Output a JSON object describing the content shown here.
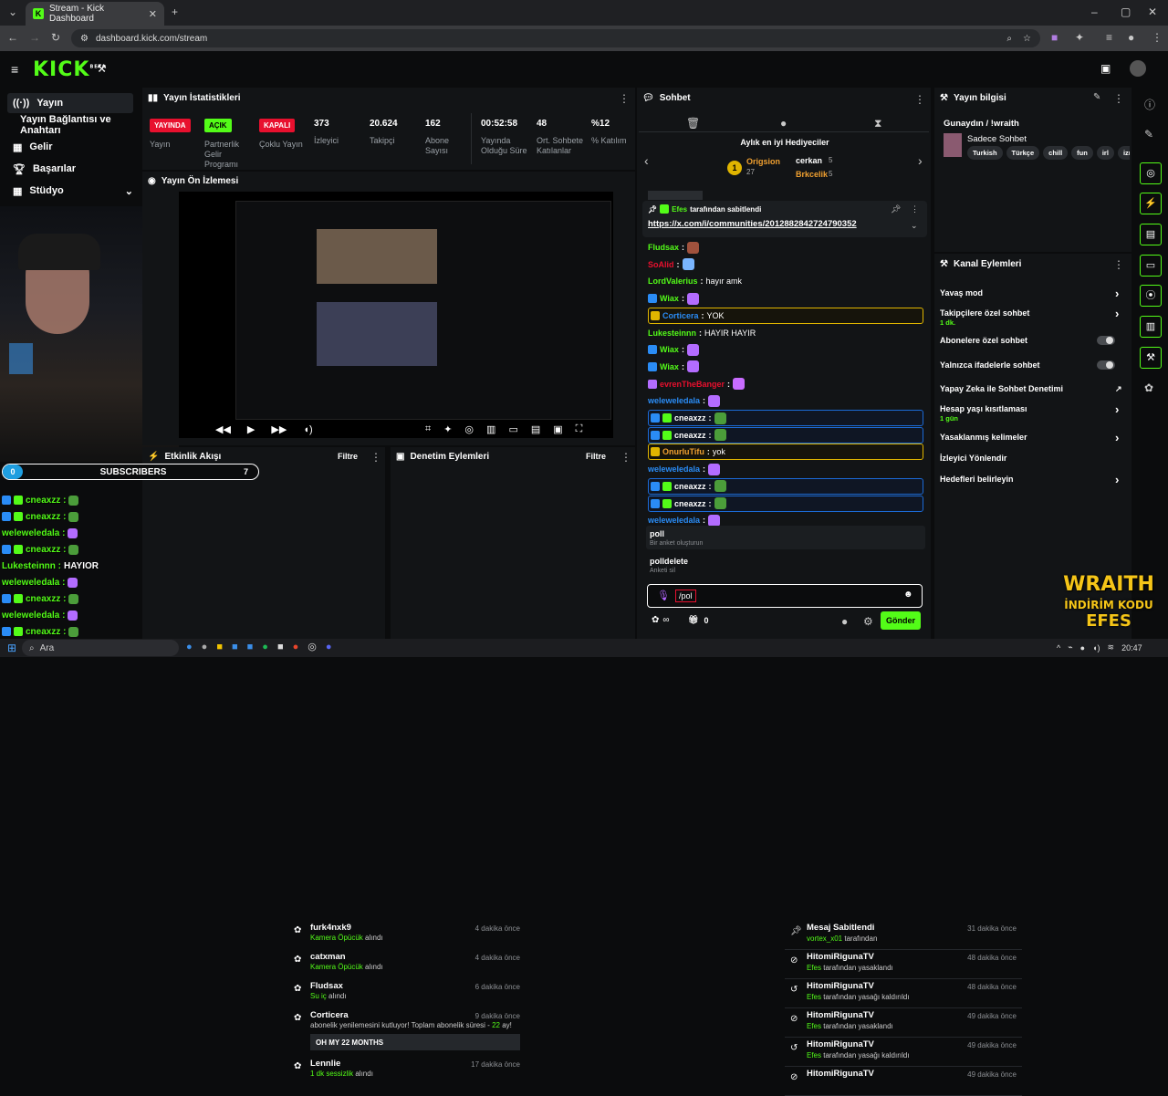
{
  "browser": {
    "tab_title": "Stream - Kick Dashboard",
    "url": "dashboard.kick.com/stream"
  },
  "header": {
    "logo": "KICK",
    "beta": "BETA"
  },
  "sidebar": {
    "items": [
      {
        "label": "Yayın",
        "icon": "broadcast-icon"
      },
      {
        "label": "Yayın Bağlantısı ve Anahtarı"
      },
      {
        "label": "Gelir",
        "icon": "grid-icon"
      },
      {
        "label": "Başarılar",
        "icon": "trophy-icon"
      },
      {
        "label": "Stüdyo",
        "icon": "grid-icon"
      }
    ]
  },
  "stats": {
    "title": "Yayın İstatistikleri",
    "badges": [
      {
        "text": "YAYINDA",
        "label": "Yayın",
        "color": "#e8102e"
      },
      {
        "text": "AÇIK",
        "label": "Partnerlik Gelir Programı",
        "color": "#53fc18"
      },
      {
        "text": "KAPALI",
        "label": "Çoklu Yayın",
        "color": "#e8102e"
      }
    ],
    "items": [
      {
        "value": "373",
        "label": "İzleyici"
      },
      {
        "value": "20.624",
        "label": "Takipçi"
      },
      {
        "value": "162",
        "label": "Abone Sayısı"
      },
      {
        "value": "00:52:58",
        "label": "Yayında Olduğu Süre"
      },
      {
        "value": "48",
        "label": "Ort. Sohbete Katılanlar"
      },
      {
        "value": "%12",
        "label": "% Katılım"
      }
    ]
  },
  "preview": {
    "title": "Yayın Ön İzlemesi"
  },
  "activity": {
    "title": "Etkinlik Akışı",
    "filter": "Filtre",
    "items": [
      {
        "name": "furk4nxk9",
        "sub": "Kamera Öpücük",
        "suffix": "alındı",
        "time": "4 dakika önce"
      },
      {
        "name": "catxman",
        "sub": "Kamera Öpücük",
        "suffix": "alındı",
        "time": "4 dakika önce"
      },
      {
        "name": "Fludsax",
        "sub": "Su iç",
        "suffix": "alındı",
        "time": "6 dakika önce"
      },
      {
        "name": "Corticera",
        "sub": "abonelik yenilemesini kutluyor! Toplam abonelik süresi - ",
        "sub2": "22",
        "sub3": " ay!",
        "time": "9 dakika önce",
        "msg": "OH MY 22 MONTHS"
      },
      {
        "name": "Lennlie",
        "sub": "1 dk sessizlik",
        "suffix": "alındı",
        "time": "17 dakika önce"
      }
    ]
  },
  "moderation": {
    "title": "Denetim Eylemleri",
    "filter": "Filtre",
    "items": [
      {
        "title": "Mesaj Sabitlendi",
        "user": "vortex_x01",
        "rest": "tarafından",
        "time": "31 dakika önce"
      },
      {
        "title": "HitomiRigunaTV",
        "user": "Efes",
        "rest": "tarafından yasaklandı",
        "time": "48 dakika önce"
      },
      {
        "title": "HitomiRigunaTV",
        "user": "Efes",
        "rest": "tarafından yasağı kaldırıldı",
        "time": "48 dakika önce"
      },
      {
        "title": "HitomiRigunaTV",
        "user": "Efes",
        "rest": "tarafından yasaklandı",
        "time": "49 dakika önce"
      },
      {
        "title": "HitomiRigunaTV",
        "user": "Efes",
        "rest": "tarafından yasağı kaldırıldı",
        "time": "49 dakika önce"
      },
      {
        "title": "HitomiRigunaTV",
        "time": "49 dakika önce"
      }
    ]
  },
  "chat": {
    "title": "Sohbet",
    "gifters_title": "Aylık en iyi Hediyeciler",
    "top1": {
      "name": "Origsion",
      "count": "27"
    },
    "top2": {
      "name": "cerkan",
      "count": "5"
    },
    "top3": {
      "name": "Brkcelik",
      "count": "5"
    },
    "pinned_by": "Efes",
    "pinned_suffix": "tarafından sabitlendi",
    "pinned_link": "https://x.com/i/communities/2012882842724790352",
    "messages": [
      {
        "user": "Fludsax",
        "color": "#53fc18",
        "text": "",
        "style": "none"
      },
      {
        "user": "SoAlid",
        "color": "#e8102e",
        "text": "",
        "style": "none"
      },
      {
        "user": "LordValerius",
        "color": "#53fc18",
        "text": " hayır amk",
        "style": "none"
      },
      {
        "user": "Wiax",
        "color": "#53fc18",
        "text": "",
        "style": "none"
      },
      {
        "user": "Corticera",
        "color": "#2a8cf6",
        "text": " YOK",
        "style": "hl"
      },
      {
        "user": "Lukesteinnn",
        "color": "#53fc18",
        "text": " HAYIR HAYIR",
        "style": "none"
      },
      {
        "user": "Wiax",
        "color": "#53fc18",
        "text": "",
        "style": "none"
      },
      {
        "user": "Wiax",
        "color": "#53fc18",
        "text": "",
        "style": "none"
      },
      {
        "user": "evrenTheBanger",
        "color": "#e8102e",
        "text": "",
        "style": "none"
      },
      {
        "user": "weleweledala",
        "color": "#2a8cf6",
        "text": "",
        "style": "none"
      },
      {
        "user": "cneaxzz",
        "color": "#fff",
        "text": "",
        "style": "bl"
      },
      {
        "user": "cneaxzz",
        "color": "#fff",
        "text": "",
        "style": "bl"
      },
      {
        "user": "OnurluTifu",
        "color": "#f0a030",
        "text": " yok",
        "style": "hl"
      },
      {
        "user": "weleweledala",
        "color": "#2a8cf6",
        "text": "",
        "style": "none"
      },
      {
        "user": "cneaxzz",
        "color": "#fff",
        "text": "",
        "style": "bl"
      },
      {
        "user": "cneaxzz",
        "color": "#fff",
        "text": "",
        "style": "bl"
      },
      {
        "user": "weleweledala",
        "color": "#2a8cf6",
        "text": "",
        "style": "none"
      }
    ],
    "commands": [
      {
        "cmd": "poll",
        "desc": "Bir anket oluşturun"
      },
      {
        "cmd": "polldelete",
        "desc": "Anketi sil"
      }
    ],
    "input_value": "/pol",
    "count": "0",
    "send": "Gönder"
  },
  "stream_info": {
    "title": "Yayın bilgisi",
    "stream_title": "Gunaydın / !wraith",
    "mode": "Sadece Sohbet",
    "tags": [
      "Turkish",
      "Türkçe",
      "chill",
      "fun",
      "irl",
      "izm"
    ]
  },
  "channel_actions": {
    "title": "Kanal Eylemleri",
    "items": [
      {
        "label": "Yavaş mod",
        "type": "chev"
      },
      {
        "label": "Takipçilere özel sohbet",
        "sub": "1 dk.",
        "type": "chev"
      },
      {
        "label": "Abonelere özel sohbet",
        "type": "toggle"
      },
      {
        "label": "Yalnızca ifadelerle sohbet",
        "type": "toggle"
      },
      {
        "label": "Yapay Zeka ile Sohbet Denetimi",
        "type": "ext"
      },
      {
        "label": "Hesap yaşı kısıtlaması",
        "sub": "1 gün",
        "type": "chev"
      },
      {
        "label": "Yasaklanmış kelimeler",
        "type": "chev"
      },
      {
        "label": "İzleyici Yönlendir",
        "type": "none"
      },
      {
        "label": "Hedefleri belirleyin",
        "type": "chev"
      }
    ]
  },
  "overlay": {
    "sub_left": "0",
    "sub_label": "SUBSCRIBERS",
    "sub_right": "7",
    "lines": [
      {
        "user": "cneaxzz :",
        "color": "#53fc18"
      },
      {
        "user": "cneaxzz :",
        "color": "#53fc18"
      },
      {
        "user": "weleweledala :",
        "color": "#53fc18"
      },
      {
        "user": "cneaxzz :",
        "color": "#53fc18"
      },
      {
        "user": "Lukesteinnn :",
        "color": "#53fc18",
        "text": " HAYIOR"
      },
      {
        "user": "weleweledala :",
        "color": "#53fc18"
      },
      {
        "user": "cneaxzz :",
        "color": "#53fc18"
      },
      {
        "user": "weleweledala :",
        "color": "#53fc18"
      },
      {
        "user": "cneaxzz :",
        "color": "#53fc18"
      }
    ],
    "brand1": "WRAITH",
    "brand2": "İNDİRİM KODU",
    "brand3": "EFES"
  },
  "taskbar": {
    "search": "Ara",
    "time": "20:47"
  }
}
